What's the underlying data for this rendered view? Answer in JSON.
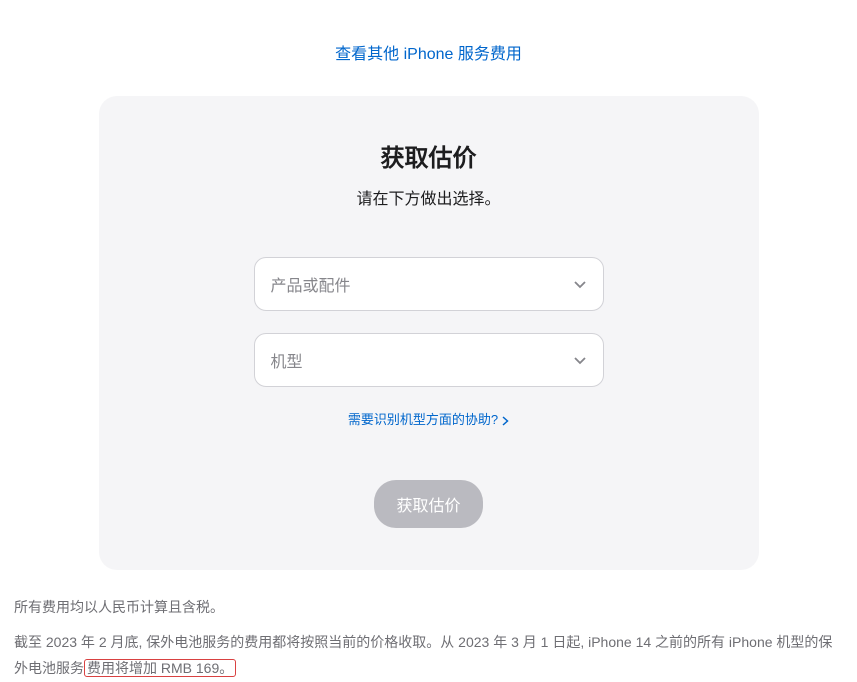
{
  "topLink": "查看其他 iPhone 服务费用",
  "card": {
    "title": "获取估价",
    "subtitle": "请在下方做出选择。",
    "select1": {
      "placeholder": "产品或配件"
    },
    "select2": {
      "placeholder": "机型"
    },
    "helpLink": "需要识别机型方面的协助?",
    "submitButton": "获取估价"
  },
  "footer": {
    "line1": "所有费用均以人民币计算且含税。",
    "line2_part1": "截至 2023 年 2 月底, 保外电池服务的费用都将按照当前的价格收取。从 2023 年 3 月 1 日起, iPhone 14 之前的所有 iPhone 机型的保外电池服务",
    "line2_highlight": "费用将增加 RMB 169。"
  }
}
